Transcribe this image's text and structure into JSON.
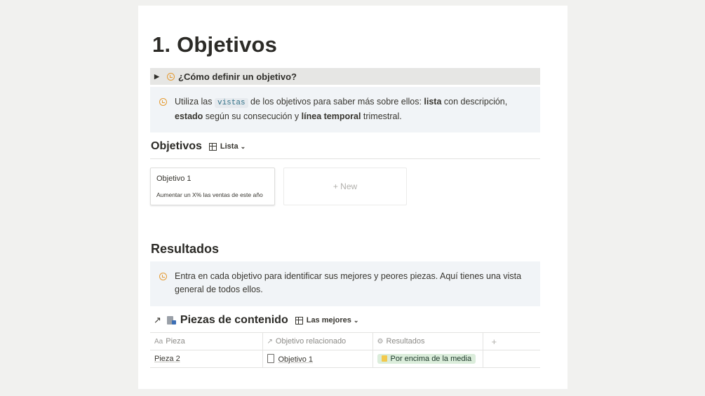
{
  "page_title": "1. Objetivos",
  "toggle": {
    "label": "¿Cómo definir un objetivo?"
  },
  "callout1": {
    "t1": "Utiliza las ",
    "code": "vistas",
    "t2": " de los objetivos para saber más sobre ellos: ",
    "b1": "lista",
    "t3": " con descripción, ",
    "b2": "estado",
    "t4": " según su consecución y ",
    "b3": "línea temporal",
    "t5": " trimestral."
  },
  "objetivos": {
    "heading": "Objetivos",
    "view_label": "Lista",
    "cards": [
      {
        "title": "Objetivo 1",
        "description": "Aumentar un X% las ventas de este año"
      }
    ],
    "new_label": "+ New"
  },
  "resultados": {
    "heading": "Resultados",
    "callout": "Entra en cada objetivo para identificar sus mejores y peores piezas. Aquí tienes una vista general de todos ellos."
  },
  "piezas": {
    "title": "Piezas de contenido",
    "view_label": "Las mejores",
    "columns": [
      "Pieza",
      "Objetivo relacionado",
      "Resultados"
    ],
    "column_icons": [
      "Aa",
      "↗",
      "⚙"
    ],
    "add_column": "+",
    "rows": [
      {
        "pieza": "Pieza 2",
        "objetivo": "Objetivo 1",
        "resultado": "Por encima de la media"
      }
    ]
  },
  "colors": {
    "accent_orange": "#e59b32",
    "callout_bg": "#f1f4f7",
    "tag_green": "#dbeddb"
  }
}
